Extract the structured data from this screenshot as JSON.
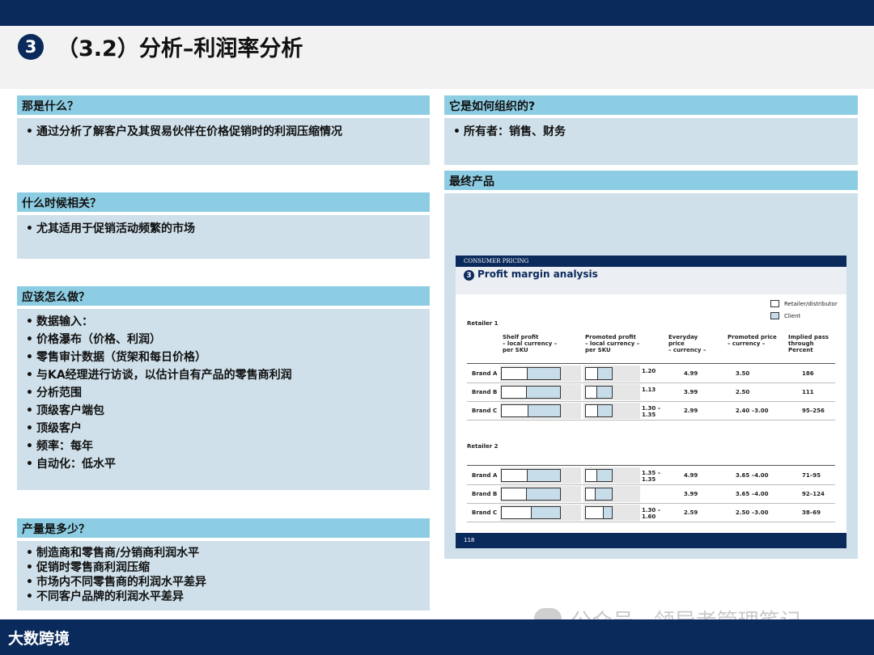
{
  "title": {
    "number": "3",
    "text": "（3.2）分析–利润率分析"
  },
  "sections": {
    "what": {
      "header": "那是什么？",
      "items": [
        "通过分析了解客户及其贸易伙伴在价格促销时的利润压缩情况"
      ]
    },
    "when": {
      "header": "什么时候相关？",
      "items": [
        "尤其适用于促销活动频繁的市场"
      ]
    },
    "how": {
      "header": "应该怎么做？",
      "items": [
        "数据输入：",
        "价格瀑布（价格、利润）",
        "零售审计数据（货架和每日价格）",
        "与KA经理进行访谈，以估计自有产品的零售商利润",
        "分析范围",
        "顶级客户端包",
        "顶级客户",
        "频率：每年",
        "自动化：低水平"
      ]
    },
    "output": {
      "header": "产量是多少？",
      "items": [
        "制造商和零售商/分销商利润水平",
        "促销时零售商利润压缩",
        "市场内不同零售商的利润水平差异",
        "不同客户品牌的利润水平差异"
      ]
    },
    "org": {
      "header": "它是如何组织的?",
      "items": [
        "所有者：销售、财务"
      ]
    },
    "final": {
      "header": "最终产品"
    }
  },
  "slide": {
    "band": "CONSUMER PRICING",
    "number": "3",
    "title": "Profit margin analysis",
    "legend": [
      "Retailer/distributor",
      "Client"
    ],
    "columns": [
      "Shelf profit\n– local currency –\nper SKU",
      "Promoted profit\n– local currency –\nper SKU",
      "Everyday\nprice\n– currency –",
      "Promoted price\n– currency –",
      "Implied pass\nthrough\nPercent"
    ],
    "retailers": [
      {
        "name": "Retailer 1",
        "rows": [
          {
            "brand": "Brand A",
            "shelf_client": 0.57,
            "promo_client": 0.55,
            "ratio": "1.20",
            "everyday": "4.99",
            "promoted": "3.50",
            "pass": "186"
          },
          {
            "brand": "Brand B",
            "shelf_client": 0.58,
            "promo_client": 0.58,
            "ratio": "1.13",
            "everyday": "3.99",
            "promoted": "2.50",
            "pass": "111"
          },
          {
            "brand": "Brand C",
            "shelf_client": 0.55,
            "promo_client": 0.55,
            "ratio": "1.30 –\n1.35",
            "everyday": "2.99",
            "promoted": "2.40 –3.00",
            "pass": "95–256"
          }
        ]
      },
      {
        "name": "Retailer 2",
        "rows": [
          {
            "brand": "Brand A",
            "shelf_client": 0.57,
            "promo_client": 0.6,
            "ratio": "1.35 –\n1.35",
            "everyday": "4.99",
            "promoted": "3.65 –4.00",
            "pass": "71–95"
          },
          {
            "brand": "Brand B",
            "shelf_client": 0.58,
            "promo_client": 0.65,
            "ratio": "",
            "everyday": "3.99",
            "promoted": "3.65 –4.00",
            "pass": "92–124"
          },
          {
            "brand": "Brand C",
            "shelf_client": 0.5,
            "promo_client": 0.35,
            "ratio": "1.30 –\n1.60",
            "everyday": "2.59",
            "promoted": "2.50 –3.00",
            "pass": "38–69"
          }
        ]
      }
    ],
    "page": "118"
  },
  "watermark": "公众号 · 领导者管理笔记",
  "brand": "大数跨境",
  "colors": {
    "navy": "#0b2a5c",
    "header": "#8dcde3",
    "box": "#cfe0ea"
  }
}
